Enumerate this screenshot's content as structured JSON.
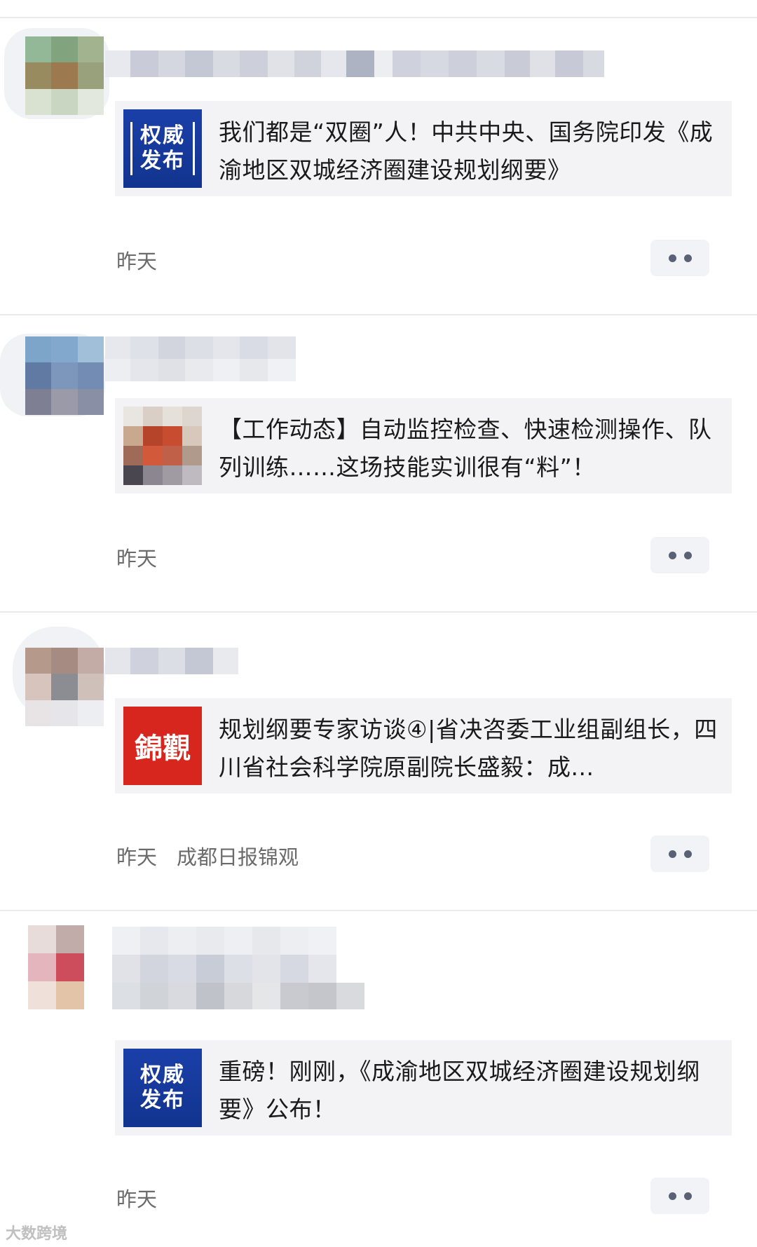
{
  "posts": [
    {
      "card_title": "我们都是“双圈”人！中共中央、国务院印发《成渝地区双城经济圈建设规划纲要》",
      "thumb_type": "blue-badge",
      "thumb_text_1": "权威",
      "thumb_text_2": "发布",
      "time": "昨天",
      "source": ""
    },
    {
      "card_title": "【工作动态】自动监控检查、快速检测操作、队列训练……这场技能实训很有“料”！",
      "thumb_type": "photo",
      "time": "昨天",
      "source": ""
    },
    {
      "card_title": "规划纲要专家访谈④|省决咨委工业组副组长，四川省社会科学院原副院长盛毅：成...",
      "thumb_type": "red-logo",
      "thumb_text_1": "錦觀",
      "time": "昨天",
      "source": "成都日报锦观"
    },
    {
      "card_title": "重磅！刚刚，《成渝地区双城经济圈建设规划纲要》公布！",
      "thumb_type": "blue-badge",
      "thumb_text_1": "权威",
      "thumb_text_2": "发布",
      "time": "昨天",
      "source": ""
    }
  ],
  "watermark": "大数跨境",
  "icons": {
    "more": "more-dots-icon"
  },
  "colors": {
    "card_bg": "#f3f3f5",
    "meta_text": "#6b6b6b",
    "blue_badge": "#1a3fa8",
    "red_logo": "#d7261e"
  }
}
